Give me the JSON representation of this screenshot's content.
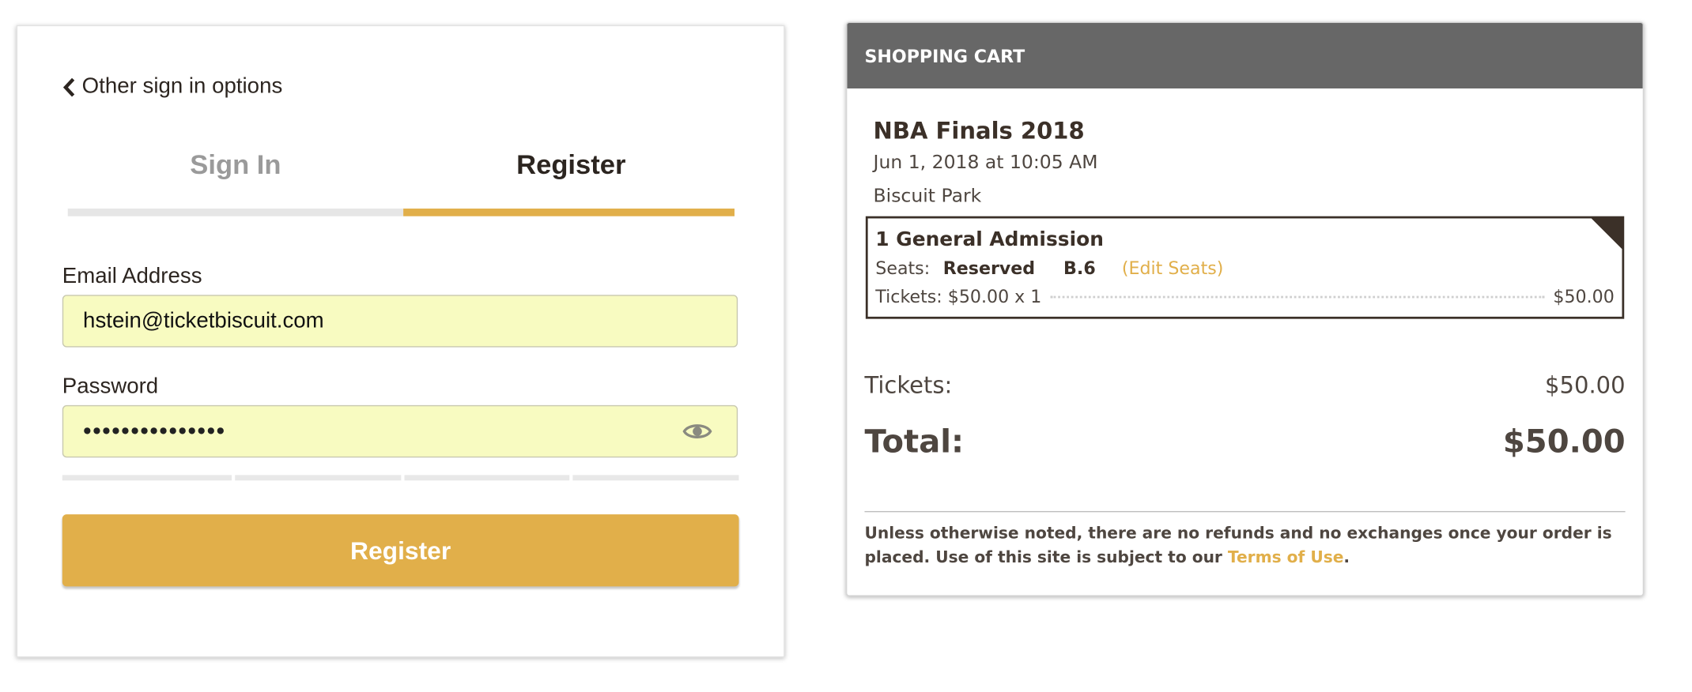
{
  "auth": {
    "back_link": "Other sign in options",
    "tabs": [
      {
        "label": "Sign In",
        "active": false
      },
      {
        "label": "Register",
        "active": true
      }
    ],
    "email": {
      "label": "Email Address",
      "value": "hstein@ticketbiscuit.com"
    },
    "password": {
      "label": "Password",
      "masked_value": "•••••••••••••••",
      "icon": "eye-icon"
    },
    "password_strength_segments_filled": 0,
    "submit_label": "Register"
  },
  "cart": {
    "header": "SHOPPING CART",
    "event": {
      "title": "NBA Finals 2018",
      "date": "Jun 1, 2018 at 10:05 AM",
      "venue": "Biscuit Park"
    },
    "ticket": {
      "name": "1 General Admission",
      "seats_label": "Seats:",
      "section": "Reserved",
      "seat": "B.6",
      "edit_label": "(Edit Seats)",
      "price_line": "Tickets: $50.00 x 1",
      "line_total": "$50.00"
    },
    "summary": {
      "tickets_label": "Tickets:",
      "tickets_value": "$50.00",
      "total_label": "Total:",
      "total_value": "$50.00"
    },
    "disclaimer": {
      "text": "Unless otherwise noted, there are no refunds and no exchanges once your order is placed. Use of this site is subject to our ",
      "link": "Terms of Use",
      "end": "."
    }
  },
  "colors": {
    "accent": "#e1af4a",
    "header_bg": "#676767",
    "input_bg": "#f8fbc1",
    "text_dark": "#3b3028"
  }
}
